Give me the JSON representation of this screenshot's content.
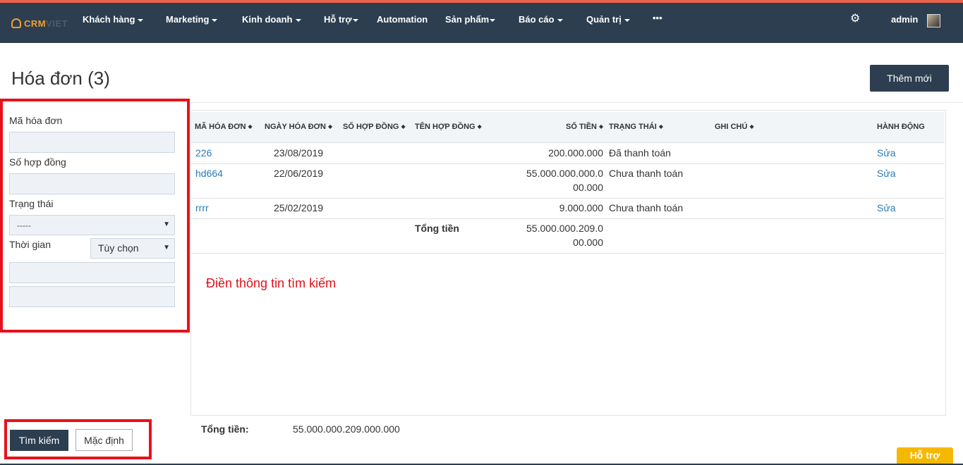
{
  "nav": {
    "logo_a": "CRM",
    "logo_b": "VIET",
    "items": [
      "Khách hàng",
      "Marketing",
      "Kinh doanh",
      "Hỗ trợ",
      "Automation",
      "Sản phẩm",
      "Báo cáo",
      "Quản trị",
      "•••"
    ],
    "user": "admin",
    "gear_icon": "gear-icon"
  },
  "page": {
    "title": "Hóa đơn (3)",
    "add_button": "Thêm mới"
  },
  "filter": {
    "invoice_code_label": "Mã hóa đơn",
    "contract_no_label": "Số hợp đồng",
    "status_label": "Trạng thái",
    "status_value": "-----",
    "time_label": "Thời gian",
    "time_value": "Tùy chọn",
    "search_button": "Tìm kiếm",
    "default_button": "Mặc định"
  },
  "table": {
    "headers": [
      "MÃ HÓA ĐƠN",
      "NGÀY HÓA ĐƠN",
      "SỐ HỢP ĐỒNG",
      "TÊN HỢP ĐỒNG",
      "SỐ TIỀN",
      "TRẠNG THÁI",
      "GHI CHÚ",
      "HÀNH ĐỘNG"
    ],
    "rows": [
      {
        "code": "226",
        "date": "23/08/2019",
        "amount_1": "200.000.000",
        "amount_2": "",
        "status": "Đã thanh toán",
        "action": "Sửa"
      },
      {
        "code": "hd664",
        "date": "22/06/2019",
        "amount_1": "55.000.000.000.0",
        "amount_2": "00.000",
        "status": "Chưa thanh toán",
        "action": "Sửa"
      },
      {
        "code": "rrrr",
        "date": "25/02/2019",
        "amount_1": "9.000.000",
        "amount_2": "",
        "status": "Chưa thanh toán",
        "action": "Sửa"
      }
    ],
    "sum_label": "Tổng tiền",
    "sum_1": "55.000.000.209.0",
    "sum_2": "00.000"
  },
  "annotation": "Điền thông tin tìm kiếm",
  "footer": {
    "total_label": "Tổng tiền:",
    "total_value": "55.000.000.209.000.000",
    "help": "Hỗ trợ"
  }
}
